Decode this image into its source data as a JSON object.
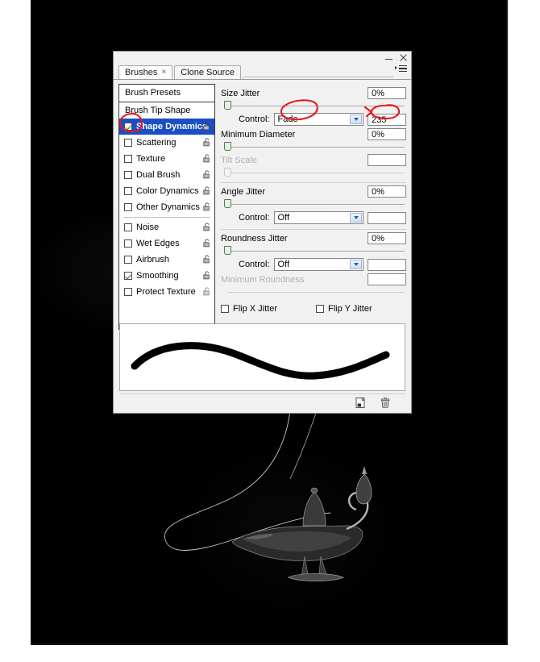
{
  "canvas": {
    "artwork_description": "genie-lamp-on-black",
    "background_color": "#000000",
    "light_trail_color": "#ffffff"
  },
  "panel": {
    "title": "Brushes",
    "window_buttons": {
      "minimize": "minimize-dash",
      "close": "close-x"
    },
    "menu_icon": "panel-menu-icon",
    "tabs": [
      {
        "label": "Brushes",
        "active": true,
        "closable": true,
        "close_glyph": "×"
      },
      {
        "label": "Clone Source",
        "active": false,
        "closable": false,
        "close_glyph": ""
      }
    ]
  },
  "sidebar": {
    "preset_row": "Brush Presets",
    "items": [
      {
        "label": "Brush Tip Shape",
        "type": "plain",
        "checked": false,
        "selected": false,
        "lock": false
      },
      {
        "label": "Shape Dynamics",
        "type": "checkbox",
        "checked": true,
        "selected": true,
        "lock": true
      },
      {
        "label": "Scattering",
        "type": "checkbox",
        "checked": false,
        "selected": false,
        "lock": true
      },
      {
        "label": "Texture",
        "type": "checkbox",
        "checked": false,
        "selected": false,
        "lock": true
      },
      {
        "label": "Dual Brush",
        "type": "checkbox",
        "checked": false,
        "selected": false,
        "lock": true
      },
      {
        "label": "Color Dynamics",
        "type": "checkbox",
        "checked": false,
        "selected": false,
        "lock": true
      },
      {
        "label": "Other Dynamics",
        "type": "checkbox",
        "checked": false,
        "selected": false,
        "lock": true
      }
    ],
    "items2": [
      {
        "label": "Noise",
        "type": "checkbox",
        "checked": false,
        "selected": false,
        "lock": true
      },
      {
        "label": "Wet Edges",
        "type": "checkbox",
        "checked": false,
        "selected": false,
        "lock": true
      },
      {
        "label": "Airbrush",
        "type": "checkbox",
        "checked": false,
        "selected": false,
        "lock": true
      },
      {
        "label": "Smoothing",
        "type": "checkbox",
        "checked": true,
        "selected": false,
        "lock": true
      },
      {
        "label": "Protect Texture",
        "type": "checkbox",
        "checked": false,
        "selected": false,
        "lock": true
      }
    ]
  },
  "controls": {
    "size_jitter": {
      "label": "Size Jitter",
      "value": "0%",
      "slider_percent": 0
    },
    "size_control": {
      "label": "Control:",
      "value": "Fade",
      "steps": "235"
    },
    "minimum_diameter": {
      "label": "Minimum Diameter",
      "value": "0%",
      "slider_percent": 0
    },
    "tilt_scale": {
      "label": "Tilt Scale",
      "value": "",
      "disabled": true
    },
    "angle_jitter": {
      "label": "Angle Jitter",
      "value": "0%",
      "slider_percent": 0
    },
    "angle_control": {
      "label": "Control:",
      "value": "Off",
      "steps": ""
    },
    "roundness_jitter": {
      "label": "Roundness Jitter",
      "value": "0%",
      "slider_percent": 0
    },
    "roundness_control": {
      "label": "Control:",
      "value": "Off",
      "steps": ""
    },
    "minimum_roundness": {
      "label": "Minimum Roundness",
      "value": "",
      "disabled": true
    },
    "flip_x": {
      "label": "Flip X Jitter",
      "checked": false
    },
    "flip_y": {
      "label": "Flip Y Jitter",
      "checked": false
    }
  },
  "footer": {
    "new_brush_icon": "new-brush-icon",
    "delete_brush_icon": "trash-icon"
  },
  "annotations": {
    "color": "#e8191f",
    "marks": [
      "circle-around-shape-dynamics-checkbox",
      "circle-around-fade-value",
      "circle-around-fade-steps-235"
    ]
  }
}
